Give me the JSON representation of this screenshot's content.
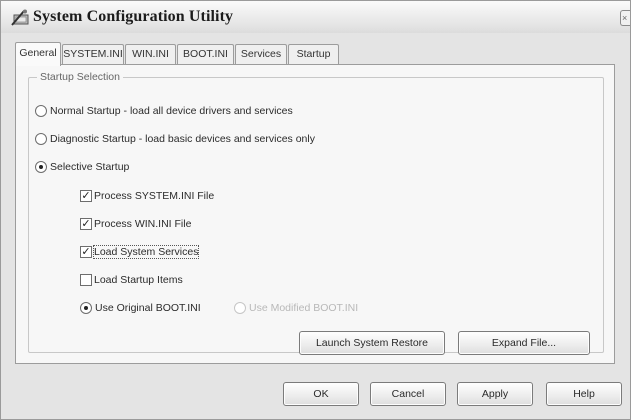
{
  "window": {
    "title": "System Configuration Utility",
    "close_glyph": "×"
  },
  "tabs": [
    {
      "label": "General",
      "active": true
    },
    {
      "label": "SYSTEM.INI",
      "active": false
    },
    {
      "label": "WIN.INI",
      "active": false
    },
    {
      "label": "BOOT.INI",
      "active": false
    },
    {
      "label": "Services",
      "active": false
    },
    {
      "label": "Startup",
      "active": false
    }
  ],
  "startup_selection": {
    "group_label": "Startup Selection",
    "normal": {
      "label": "Normal Startup - load all device drivers and services",
      "checked": false
    },
    "diagnostic": {
      "label": "Diagnostic Startup - load basic devices and services only",
      "checked": false
    },
    "selective": {
      "label": "Selective Startup",
      "checked": true
    },
    "options": [
      {
        "label": "Process SYSTEM.INI File",
        "checked": true
      },
      {
        "label": "Process WIN.INI File",
        "checked": true
      },
      {
        "label": "Load System Services",
        "checked": true
      },
      {
        "label": "Load Startup Items",
        "checked": false
      }
    ],
    "boot_original": {
      "label": "Use Original BOOT.INI",
      "checked": true
    },
    "boot_modified": {
      "label": "Use Modified BOOT.INI",
      "checked": false,
      "disabled": true
    }
  },
  "panel_buttons": {
    "launch_restore": "Launch System Restore",
    "expand_file": "Expand File..."
  },
  "dialog_buttons": {
    "ok": "OK",
    "cancel": "Cancel",
    "apply": "Apply",
    "help": "Help"
  },
  "check_glyph": "✓"
}
